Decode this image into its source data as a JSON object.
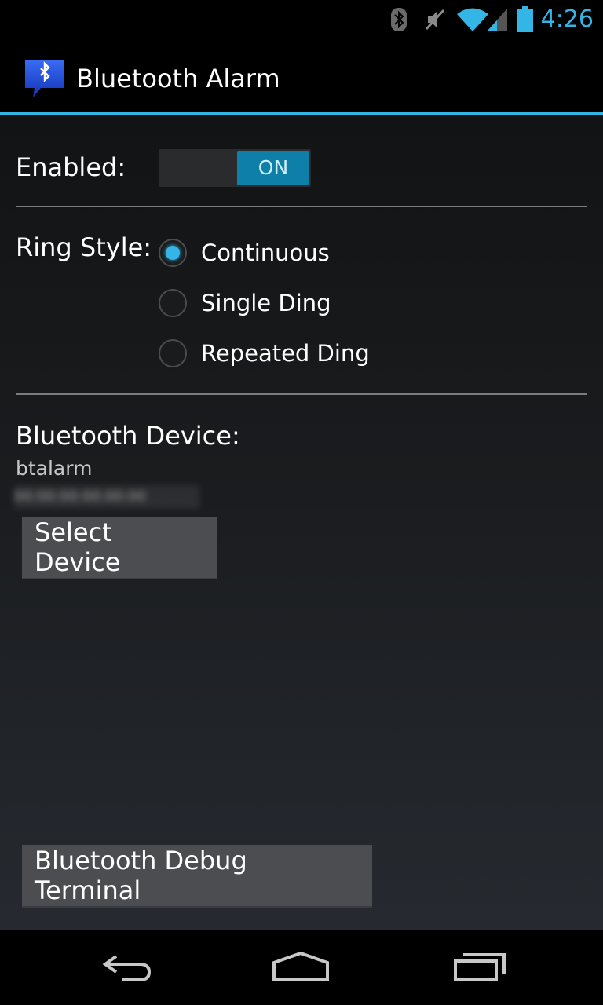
{
  "status_bar": {
    "time": "4:26",
    "icons": [
      "bluetooth-icon",
      "mute-icon",
      "wifi-icon",
      "cell-signal-icon",
      "battery-icon"
    ],
    "accent_color": "#33b5e5"
  },
  "action_bar": {
    "title": "Bluetooth Alarm",
    "icon": "bluetooth-chat-icon"
  },
  "enabled": {
    "label": "Enabled:",
    "toggle_state": "ON"
  },
  "ring_style": {
    "label": "Ring Style:",
    "options": [
      {
        "label": "Continuous",
        "checked": true
      },
      {
        "label": "Single Ding",
        "checked": false
      },
      {
        "label": "Repeated Ding",
        "checked": false
      }
    ]
  },
  "bluetooth_device": {
    "label": "Bluetooth Device:",
    "name": "btalarm",
    "address": "00:00:00:00:00:00",
    "select_button": "Select Device"
  },
  "debug_button": "Bluetooth Debug Terminal",
  "nav_bar": {
    "icons": [
      "back-icon",
      "home-icon",
      "recents-icon"
    ]
  }
}
